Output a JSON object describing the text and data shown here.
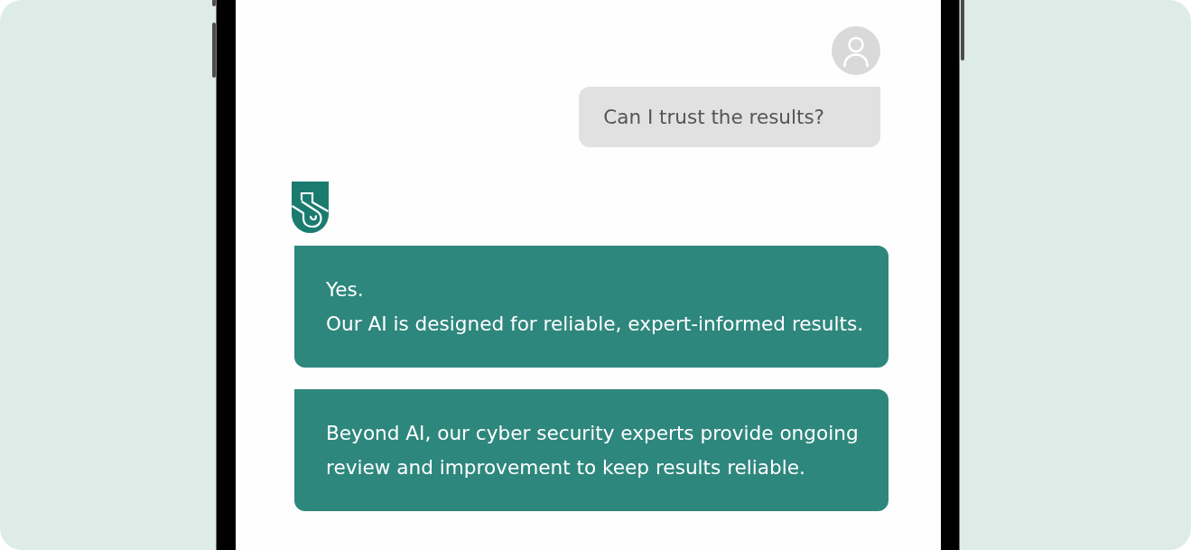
{
  "conversation": [
    {
      "kind": "user",
      "bubbles": [
        {
          "lines": [
            "Can I trust the results?"
          ]
        }
      ]
    },
    {
      "kind": "bot",
      "bubbles": [
        {
          "lines": [
            "Yes.",
            "Our AI is designed for reliable, expert-informed results."
          ]
        },
        {
          "lines": [
            "Beyond AI, our cyber security experts provide ongoing review and improvement to keep results reliable."
          ]
        }
      ]
    }
  ]
}
